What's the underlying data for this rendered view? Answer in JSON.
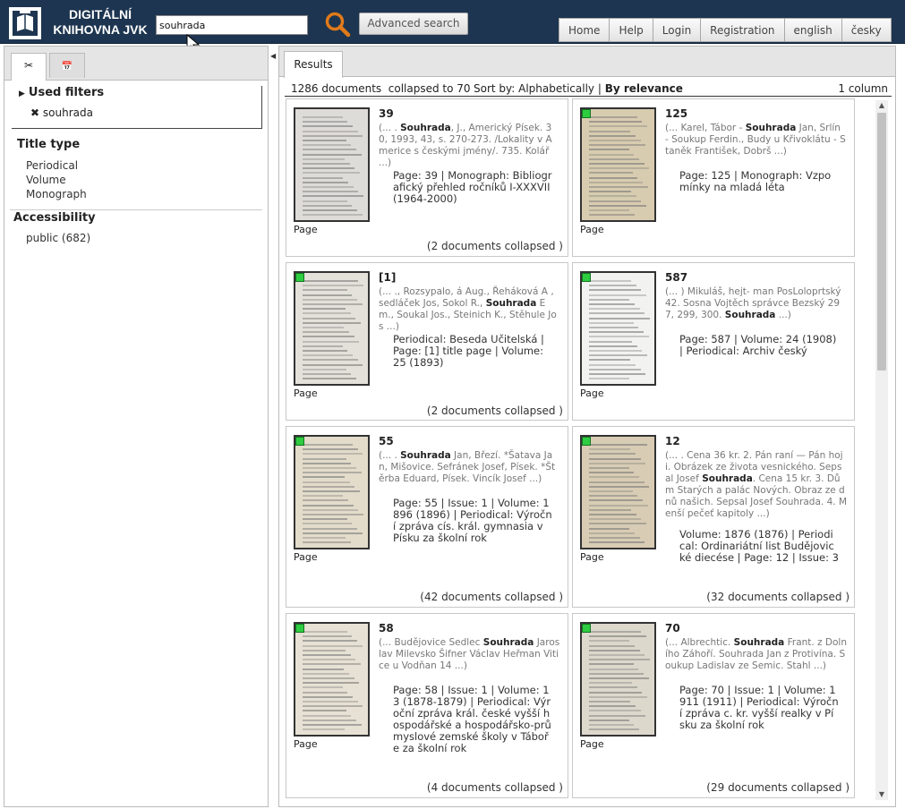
{
  "header": {
    "logo_line1": "DIGITÁLNÍ",
    "logo_line2": "KNIHOVNA JVK",
    "search_value": "souhrada",
    "advanced_label": "Advanced search",
    "nav": [
      "Home",
      "Help",
      "Login",
      "Registration",
      "english",
      "česky"
    ]
  },
  "left": {
    "used_filters_title": "Used filters",
    "active_filter": "souhrada",
    "title_type_label": "Title type",
    "title_types": [
      "Periodical",
      "Volume",
      "Monograph"
    ],
    "accessibility_label": "Accessibility",
    "accessibility_items": [
      "public (682)"
    ]
  },
  "right": {
    "tab_label": "Results",
    "count_text": "1286 documents  collapsed to 70",
    "sort_label": "Sort by:",
    "sort_alpha": "Alphabetically",
    "sort_relevance": "By relevance",
    "columns_label": "1 column"
  },
  "cards": [
    {
      "title": "39",
      "snippet_pre": "(... . ",
      "snippet_bold": "Souhrada",
      "snippet_post": ", J., Americký Písek. 30, 1993, 43, s. 270-273. /Lokality v Americe s českými jmény/. 735. Kolář ...)",
      "desc": "Page: 39    |  Monograph: Bibliografický přehled ročníků I-XXXVII (1964-2000)",
      "page_label": "Page",
      "collapsed": "(2 documents collapsed )",
      "public": false
    },
    {
      "title": "125",
      "snippet_pre": "(... Karel, Tábor - ",
      "snippet_bold": "Souhrada",
      "snippet_post": " Jan, Srlín - Soukup Ferdin., Budy u Křivoklátu - Staněk František, Dobrš ...)",
      "desc": "Page: 125    |  Monograph: Vzpomínky na mladá léta",
      "page_label": "Page",
      "collapsed": "",
      "public": true
    },
    {
      "title": "[1]",
      "snippet_pre": "(... ., Rozsypalo, á Aug., Řeháková A , sedláček Jos, Sokol R., ",
      "snippet_bold": "Souhrada",
      "snippet_post": " Em., Soukal Jos., Steinich K., Stěhule Jos ...)",
      "desc": "Periodical: Beseda Učitelská |  Page: [1]   title page  |  Volume: 25  (1893)",
      "page_label": "Page",
      "collapsed": "(2 documents collapsed )",
      "public": true
    },
    {
      "title": "587",
      "snippet_pre": "(... ) Mikuláš, hejt- man PosLoloprtský 42. Sosna Vojtěch správce Bezský 297, 299, 300. ",
      "snippet_bold": "Souhrada",
      "snippet_post": " ...)",
      "desc": "Page: 587    |  Volume: 24  (1908)  |  Periodical: Archiv český",
      "page_label": "Page",
      "collapsed": "",
      "public": true
    },
    {
      "title": "55",
      "snippet_pre": "(... . ",
      "snippet_bold": "Souhrada",
      "snippet_post": " Jan, Březí. *Šatava Jan, Mišovice. Sefránek Josef, Písek. *Štěrba Eduard, Písek. Vincík Josef ...)",
      "desc": "Page: 55    |  Issue: 1   |  Volume: 1896  (1896)  |  Periodical: Výroční zpráva cís. král. gymnasia v Písku za školní rok",
      "page_label": "Page",
      "collapsed": "(42 documents collapsed )",
      "public": true
    },
    {
      "title": "12",
      "snippet_pre": "(... . Cena 36 kr. 2. Pán raní — Pán hoji. Obrázek ze života vesnického. Sepsal Josef ",
      "snippet_bold": "Souhrada",
      "snippet_post": ". Cena 15 kr. 3. Dům Starých a palác Nových. Obraz ze dnů našich. Sepsal Josef Souhrada. 4. Menší pečeť kapitoly ...)",
      "desc": "Volume: 1876  (1876)  |  Periodical: Ordinariátní list Budějovické diecése  |  Page: 12    |  Issue: 3",
      "page_label": "Page",
      "collapsed": "(32 documents collapsed )",
      "public": true
    },
    {
      "title": "58",
      "snippet_pre": "(... Budějovice Sedlec ",
      "snippet_bold": "Souhrada",
      "snippet_post": " Jaroslav Milevsko Šifner Václav Heřman Vitice u Vodňan 14 ...)",
      "desc": "Page: 58    |  Issue: 1   |  Volume: 13  (1878-1879)  |  Periodical: Výroční zpráva král. české vyšší hospodářské a hospodářsko-průmyslové zemské školy v Táboře za školní rok",
      "page_label": "Page",
      "collapsed": "(4 documents collapsed )",
      "public": true
    },
    {
      "title": "70",
      "snippet_pre": "(... Albrechtic. ",
      "snippet_bold": "Souhrada",
      "snippet_post": " Frant. z Dolního Záhoří. Souhrada Jan z Protivína. Soukup Ladislav ze Semic. Stahl ...)",
      "desc": "Page: 70    |  Issue: 1   |  Volume: 1911  (1911)  |  Periodical: Výroční zpráva c. kr. vyšší realky v Písku za školní rok",
      "page_label": "Page",
      "collapsed": "(29 documents collapsed )",
      "public": true
    }
  ]
}
